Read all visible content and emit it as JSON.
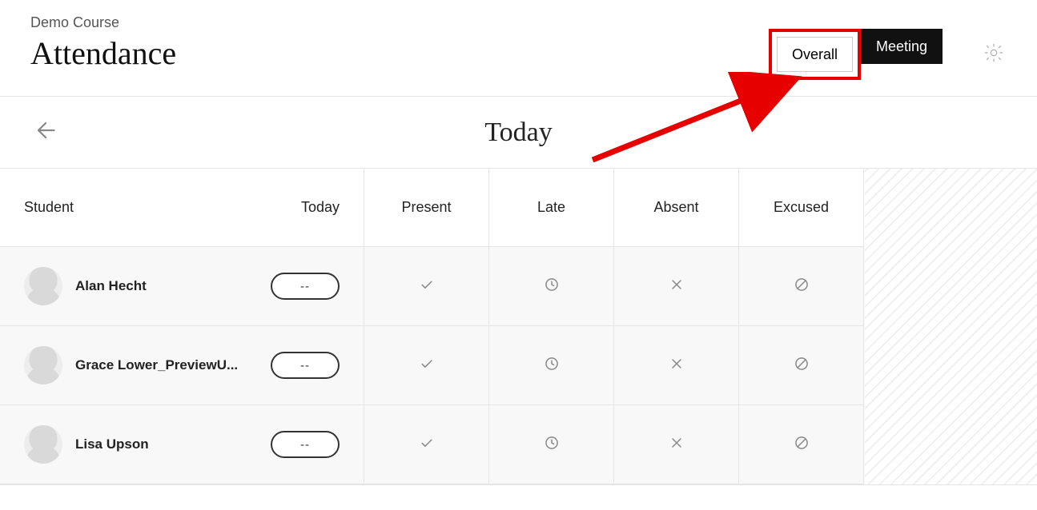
{
  "header": {
    "course_name": "Demo Course",
    "page_title": "Attendance",
    "view_tabs": {
      "overall": "Overall",
      "meeting": "Meeting"
    }
  },
  "today_bar": {
    "title": "Today"
  },
  "table": {
    "columns": {
      "student": "Student",
      "today": "Today",
      "present": "Present",
      "late": "Late",
      "absent": "Absent",
      "excused": "Excused"
    },
    "rows": [
      {
        "name": "Alan Hecht",
        "today_value": "--"
      },
      {
        "name": "Grace Lower_PreviewU...",
        "today_value": "--"
      },
      {
        "name": "Lisa Upson",
        "today_value": "--"
      }
    ]
  }
}
